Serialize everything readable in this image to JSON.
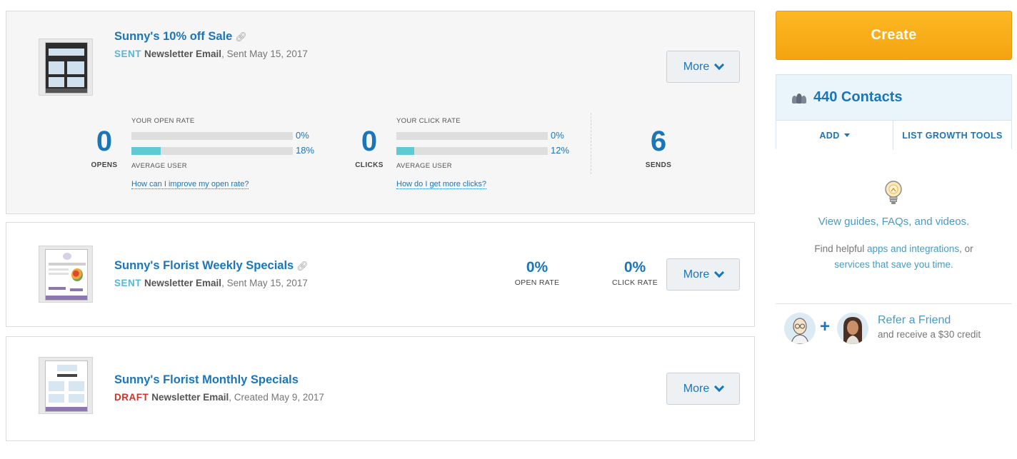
{
  "campaigns": [
    {
      "title": "Sunny's 10% off Sale",
      "status": "SENT",
      "type": "Newsletter Email",
      "date_text": ", Sent May 15, 2017",
      "more_label": "More",
      "stats": {
        "opens": {
          "value": "0",
          "label": "OPENS"
        },
        "open_rate": {
          "caption": "YOUR OPEN RATE",
          "your_value": "0%",
          "your_fraction": 0.0,
          "avg_value": "18%",
          "avg_fraction": 0.18,
          "avg_caption": "AVERAGE USER",
          "help_link": "How can I improve my open rate?"
        },
        "clicks": {
          "value": "0",
          "label": "CLICKS"
        },
        "click_rate": {
          "caption": "YOUR CLICK RATE",
          "your_value": "0%",
          "your_fraction": 0.0,
          "avg_value": "12%",
          "avg_fraction": 0.12,
          "avg_caption": "AVERAGE USER",
          "help_link": "How do I get more clicks?"
        },
        "sends": {
          "value": "6",
          "label": "SENDS"
        }
      }
    },
    {
      "title": "Sunny's Florist Weekly Specials",
      "status": "SENT",
      "type": "Newsletter Email",
      "date_text": ", Sent May 15, 2017",
      "more_label": "More",
      "open_rate": {
        "value": "0%",
        "label": "OPEN RATE"
      },
      "click_rate": {
        "value": "0%",
        "label": "CLICK RATE"
      }
    },
    {
      "title": "Sunny's Florist Monthly Specials",
      "status": "DRAFT",
      "type": "Newsletter Email",
      "date_text": ", Created May 9, 2017",
      "more_label": "More"
    }
  ],
  "sidebar": {
    "create_label": "Create",
    "contacts_label": "440 Contacts",
    "add_label": "ADD",
    "growth_label": "LIST GROWTH TOOLS",
    "guides_text": "View guides, FAQs, and videos.",
    "helpful_prefix": "Find helpful ",
    "helpful_link": "apps and integrations",
    "helpful_mid": ", or",
    "helpful_link2": "services that save you time.",
    "refer_title": "Refer a Friend",
    "refer_sub": "and receive a $30 credit",
    "plus": "+"
  },
  "colors": {
    "brand_blue": "#1a76b9",
    "create_orange": "#f4a411",
    "sent_status": "#58b7d9",
    "draft_status": "#d0342c",
    "rate_fill": "#5fcad3"
  },
  "icons": [
    "link-icon",
    "chevron-down-icon",
    "people-icon",
    "lightbulb-icon",
    "caret-down-icon"
  ]
}
